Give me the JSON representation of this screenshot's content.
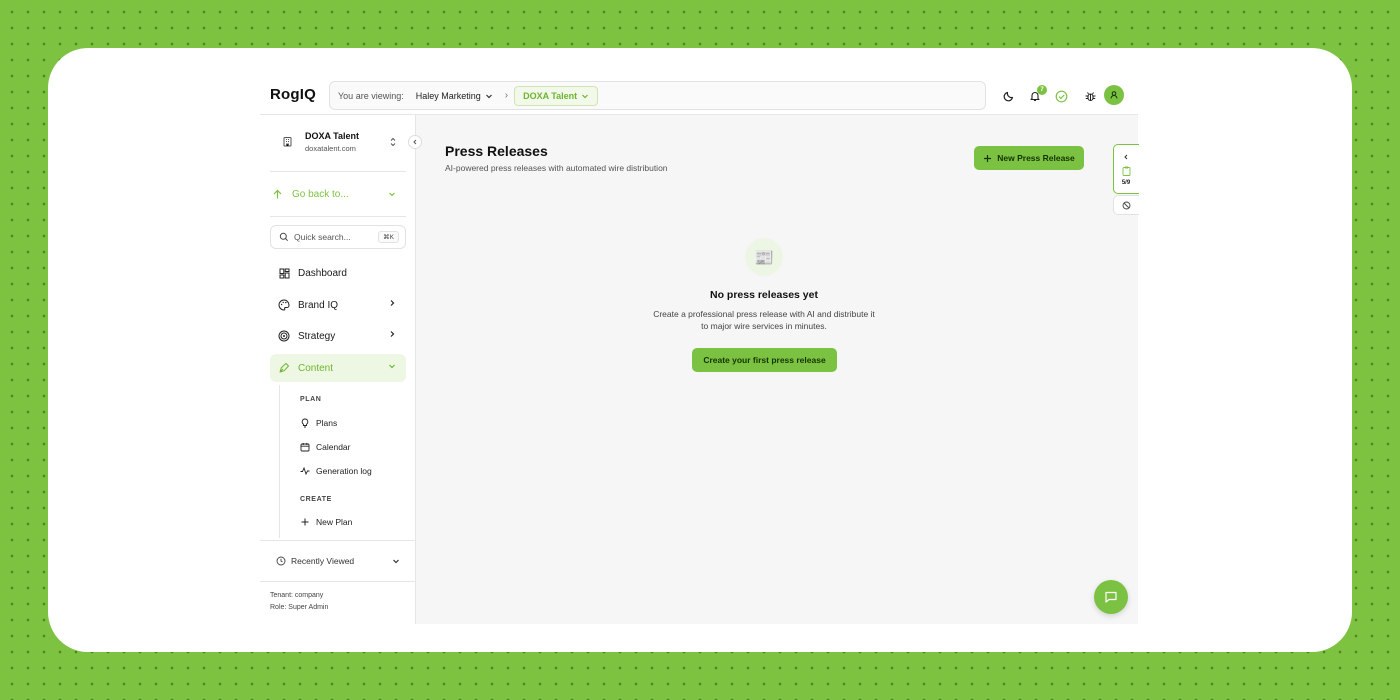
{
  "header": {
    "logo": "RogIQ",
    "viewing_label": "You are viewing:",
    "org": "Haley Marketing",
    "separator": "›",
    "client": "DOXA Talent",
    "notifications_count": "7"
  },
  "sidebar": {
    "tenant_name": "DOXA Talent",
    "tenant_domain": "doxatalent.com",
    "go_back": "Go back to...",
    "search_placeholder": "Quick search...",
    "search_shortcut": "⌘K",
    "nav": {
      "dashboard": "Dashboard",
      "brand_iq": "Brand IQ",
      "strategy": "Strategy",
      "content": "Content"
    },
    "sections": {
      "plan": "PLAN",
      "create": "CREATE"
    },
    "sub": {
      "plans": "Plans",
      "calendar": "Calendar",
      "generation_log": "Generation log",
      "new_plan": "New Plan"
    },
    "recently_viewed": "Recently Viewed",
    "tenant_info": "Tenant: company",
    "role_info": "Role: Super Admin"
  },
  "main": {
    "title": "Press Releases",
    "subtitle": "AI-powered press releases with automated wire distribution",
    "new_button": "New Press Release",
    "empty_icon": "📰",
    "empty_title": "No press releases yet",
    "empty_desc_line1": "Create a professional press release with AI and distribute it",
    "empty_desc_line2": "to major wire services in minutes.",
    "first_button": "Create your first press release"
  },
  "widget": {
    "count": "5/9"
  },
  "colors": {
    "accent": "#7cc242",
    "background": "#7dc241"
  }
}
